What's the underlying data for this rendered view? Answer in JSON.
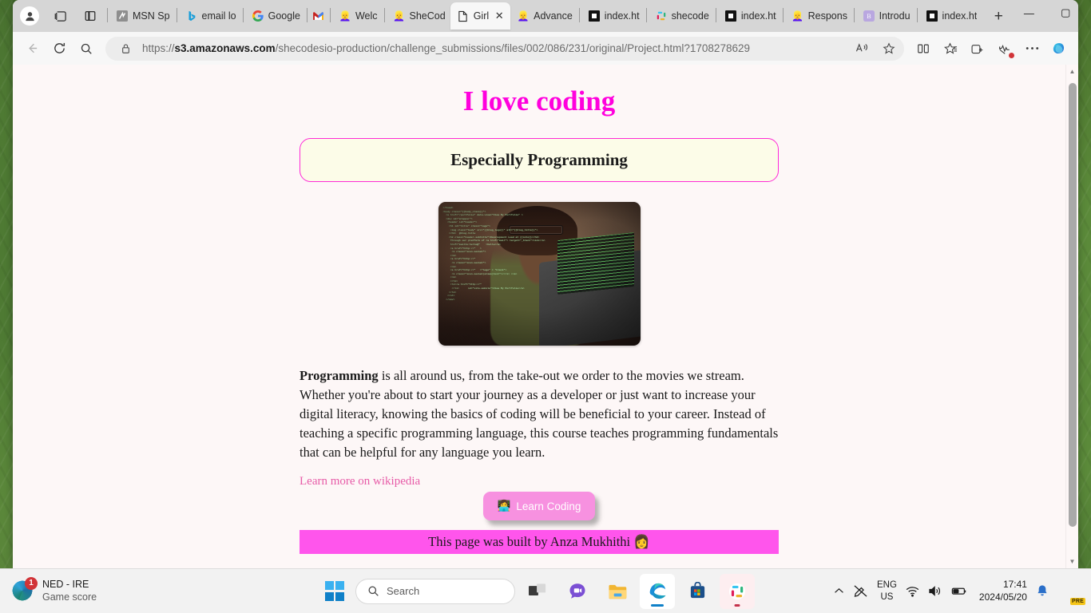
{
  "browser": {
    "tabs": [
      {
        "label": "MSN Sp",
        "icon": "msn-icon",
        "active": false
      },
      {
        "label": "email lo",
        "icon": "bing-icon",
        "active": false
      },
      {
        "label": "Google",
        "icon": "google-icon",
        "active": false
      },
      {
        "label": "Welc",
        "icon": "shecodes-icon",
        "active": false
      },
      {
        "label": "SheCod",
        "icon": "shecodes-icon",
        "active": false
      },
      {
        "label": "Girl",
        "icon": "document-icon",
        "active": true
      },
      {
        "label": "Advance",
        "icon": "shecodes-icon",
        "active": false
      },
      {
        "label": "index.ht",
        "icon": "vscode-icon",
        "active": false
      },
      {
        "label": "shecode",
        "icon": "slack-icon",
        "active": false
      },
      {
        "label": "index.ht",
        "icon": "vscode-icon",
        "active": false
      },
      {
        "label": "Respons",
        "icon": "shecodes-icon",
        "active": false
      },
      {
        "label": "Introdu",
        "icon": "brand-b-icon",
        "active": false
      },
      {
        "label": "index.ht",
        "icon": "vscode-icon",
        "active": false
      }
    ],
    "gmail_tab_label": "M",
    "new_tab_label": "+",
    "window_controls": {
      "minimize": "—",
      "maximize": "▢",
      "close": "✕"
    },
    "nav": {
      "back": "←",
      "refresh": "⟳",
      "search": "search-icon"
    },
    "url_prefix": "https://",
    "url_domain": "s3.amazonaws.com",
    "url_path": "/shecodesio-production/challenge_submissions/files/002/086/231/original/Project.html?1708278629",
    "toolbar_icons": [
      "read-aloud-icon",
      "favorite-star-icon",
      "split-screen-icon",
      "favorites-icon",
      "collections-icon",
      "browser-essentials-icon",
      "settings-more-icon",
      "copilot-icon"
    ]
  },
  "page": {
    "title": "I love coding",
    "subtitle": "Especially Programming",
    "hero_image_alt": "woman-coding-photo",
    "hero_code_overlay": "</head>\n<body class=\"{{body_class}}\">\n  <a href=\"/portfolio\" data-view=\"View My Portfolio\" >\n  <div id=\"wrapper\">\n   <header id=\"header\">\n    <h1 id=\"title\" class=\"logo\">\n     <img class=\"body\" src=\"{{blog_logo}}\" alt=\"{{blog_title}}\">\n    </h1>  @blog.title\n    <h2 class=\"header-subtitle\">Development Lead at {{site}}</h2>\n     Through our platform of <a href=\"mail\"> target=\"_blank\">link</a>\n     href=\"mailto:hello@\"    >hello</a>\n     <a href=\"http://\"   >\n      <i class=\"icon-social\">\n     </a>\n     <a href=\"http://\"\n      <i class=\"icon-social\">\n     </a>\n     <a href=\"http://\"   >\"logo\" = \"blank\">\n      <i class=\"icon-social(alias)text\">/</i> </a>\n     </a>\n     </li>\n     <li><a href=\"http://\"\n      </li>      id=\"site-mobile\">View My Portfolio</a>\n    </li>\n   </ul>\n  </nav>",
    "paragraph_lead": "Programming",
    "paragraph_rest": " is all around us, from the take-out we order to the movies we stream. Whether you're about to start your journey as a developer or just want to increase your digital literacy, knowing the basics of coding will be beneficial to your career. Instead of teaching a specific programming language, this course teaches programming fundamentals that can be helpful for any language you learn.",
    "wiki_link": "Learn more on wikipedia",
    "button_label": "Learn Coding",
    "button_emoji": "👩‍💻",
    "footer_text": "This page was built by Anza Mukhithi 👩",
    "colors": {
      "title": "#ff00dd",
      "subtitle_border": "#ff2bd6",
      "subtitle_bg": "#fcfce8",
      "page_bg": "#fdf7f7",
      "button_bg": "#f791e0",
      "footer_bg": "#ff55ec",
      "link": "#e75ca8"
    }
  },
  "taskbar": {
    "widget": {
      "title": "NED - IRE",
      "subtitle": "Game score",
      "badge": "1"
    },
    "start_label": "start-button",
    "search_placeholder": "Search",
    "apps": [
      "task-view-icon",
      "chat-icon",
      "file-explorer-icon",
      "edge-icon",
      "microsoft-store-icon",
      "slack-icon"
    ],
    "tray": {
      "chevron": "^",
      "language_line1": "ENG",
      "language_line2": "US",
      "time": "17:41",
      "date": "2024/05/20",
      "icons": [
        "hidden-icons-chevron",
        "no-pen-icon",
        "wifi-icon",
        "volume-icon",
        "battery-icon",
        "notification-bell-icon",
        "copilot-icon"
      ],
      "copilot_badge": "PRE"
    }
  }
}
